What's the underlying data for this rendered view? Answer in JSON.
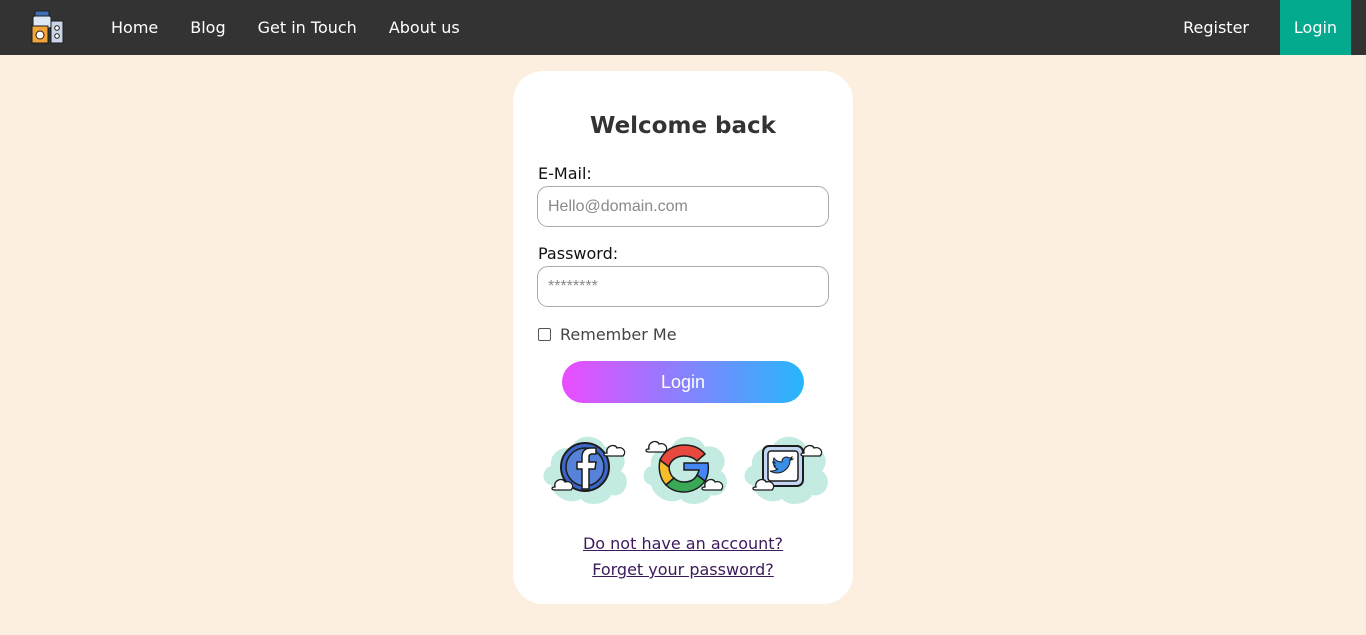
{
  "nav": {
    "items": [
      {
        "label": "Home"
      },
      {
        "label": "Blog"
      },
      {
        "label": "Get in Touch"
      },
      {
        "label": "About us"
      }
    ],
    "register_label": "Register",
    "login_label": "Login",
    "login_color": "#04aa8d",
    "bar_color": "#333333"
  },
  "form": {
    "title": "Welcome back",
    "email_label": "E-Mail:",
    "email_placeholder": "Hello@domain.com",
    "email_value": "",
    "password_label": "Password:",
    "password_placeholder": "********",
    "password_value": "",
    "remember_label": "Remember Me",
    "remember_checked": false,
    "login_button": "Login",
    "gradient": [
      "#ea4cff",
      "#26b7fb"
    ]
  },
  "social": [
    {
      "icon": "facebook-icon"
    },
    {
      "icon": "google-icon"
    },
    {
      "icon": "twitter-icon"
    }
  ],
  "links": {
    "register": "Do not have an account?",
    "forgot": "Forget your password?"
  },
  "colors": {
    "page_background": "#fcefe0",
    "card_background": "#ffffff",
    "link": "#3c1a5b"
  }
}
